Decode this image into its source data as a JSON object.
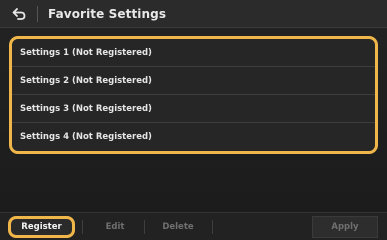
{
  "header": {
    "back_icon": "back-arrow-icon",
    "title": "Favorite Settings"
  },
  "list": {
    "items": [
      {
        "label": "Settings 1 (Not Registered)"
      },
      {
        "label": "Settings 2 (Not Registered)"
      },
      {
        "label": "Settings 3 (Not Registered)"
      },
      {
        "label": "Settings 4 (Not Registered)"
      }
    ]
  },
  "footer": {
    "register_label": "Register",
    "edit_label": "Edit",
    "delete_label": "Delete",
    "apply_label": "Apply"
  },
  "colors": {
    "focus_highlight": "#f0b64a",
    "background": "#1b1b1b",
    "text": "#e6e6e6",
    "disabled_text": "#6f6f6f"
  }
}
